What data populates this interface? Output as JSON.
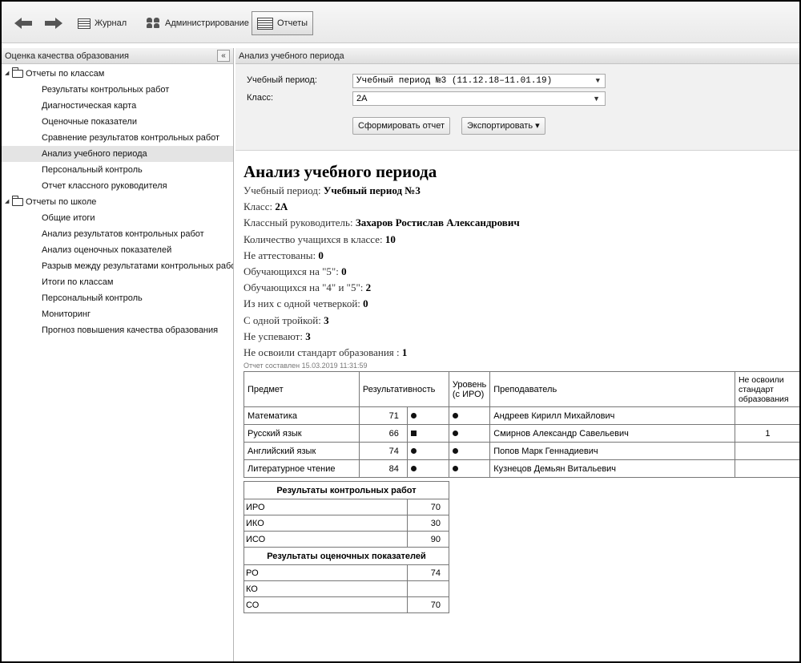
{
  "toolbar": {
    "journal_label": "Журнал",
    "admin_label": "Администрирование",
    "reports_label": "Отчеты"
  },
  "sidebar": {
    "title": "Оценка качества образования",
    "collapse_glyph": "«",
    "groups": [
      {
        "label": "Отчеты по классам",
        "items": [
          "Результаты контрольных работ",
          "Диагностическая карта",
          "Оценочные показатели",
          "Сравнение результатов контрольных работ",
          "Анализ учебного периода",
          "Персональный контроль",
          "Отчет классного руководителя"
        ]
      },
      {
        "label": "Отчеты по школе",
        "items": [
          "Общие итоги",
          "Анализ результатов контрольных работ",
          "Анализ оценочных показателей",
          "Разрыв между результатами контрольных работ",
          "Итоги по классам",
          "Персональный контроль",
          "Мониторинг",
          "Прогноз повышения качества образования"
        ]
      }
    ],
    "selected": "Анализ учебного периода"
  },
  "main": {
    "panel_title": "Анализ учебного периода",
    "filters": {
      "period_label": "Учебный период:",
      "period_value": "Учебный период №3 (11.12.18–11.01.19)",
      "class_label": "Класс:",
      "class_value": "2А",
      "generate_button": "Сформировать отчет",
      "export_button": "Экспортировать ▾"
    },
    "report": {
      "title": "Анализ учебного периода",
      "lines": [
        {
          "label": "Учебный период: ",
          "value": "Учебный период №3"
        },
        {
          "label": "Класс: ",
          "value": "2А"
        },
        {
          "label": "Классный руководитель: ",
          "value": "Захаров Ростислав Александрович"
        },
        {
          "label": "Количество учащихся в классе: ",
          "value": "10"
        },
        {
          "label": "Не аттестованы: ",
          "value": "0"
        },
        {
          "label": "Обучающихся на \"5\": ",
          "value": "0"
        },
        {
          "label": "Обучающихся на \"4\" и \"5\": ",
          "value": "2"
        },
        {
          "label": "Из них с одной четверкой: ",
          "value": "0"
        },
        {
          "label": "С одной тройкой: ",
          "value": "3"
        },
        {
          "label": "Не успевают: ",
          "value": "3"
        },
        {
          "label": "Не освоили стандарт образования : ",
          "value": "1"
        }
      ],
      "stamp": "Отчет составлен 15.03.2019 11:31:59"
    },
    "table": {
      "headers": {
        "subject": "Предмет",
        "result": "Результативность",
        "level_1": "Уровень",
        "level_2": "(с ИРО)",
        "teacher": "Преподаватель",
        "not_mastered_1": "Не освоили",
        "not_mastered_2": "стандарт",
        "not_mastered_3": "образования"
      },
      "rows": [
        {
          "subject": "Математика",
          "result": "71",
          "marker": "dot",
          "level": "dot",
          "teacher": "Андреев Кирилл Михайлович",
          "not_mastered": ""
        },
        {
          "subject": "Русский язык",
          "result": "66",
          "marker": "square",
          "level": "dot",
          "teacher": "Смирнов Александр Савельевич",
          "not_mastered": "1"
        },
        {
          "subject": "Английский язык",
          "result": "74",
          "marker": "dot",
          "level": "dot",
          "teacher": "Попов Марк Геннадиевич",
          "not_mastered": ""
        },
        {
          "subject": "Литературное чтение",
          "result": "84",
          "marker": "dot",
          "level": "dot",
          "teacher": "Кузнецов Демьян Витальевич",
          "not_mastered": ""
        }
      ]
    },
    "control_results": {
      "title": "Результаты контрольных работ",
      "rows": [
        {
          "label": "ИРО",
          "value": "70"
        },
        {
          "label": "ИКО",
          "value": "30"
        },
        {
          "label": "ИСО",
          "value": "90"
        }
      ]
    },
    "estimate_results": {
      "title": "Результаты оценочных показателей",
      "rows": [
        {
          "label": "РО",
          "value": "74"
        },
        {
          "label": "КО",
          "value": ""
        },
        {
          "label": "СО",
          "value": "70"
        }
      ]
    }
  }
}
